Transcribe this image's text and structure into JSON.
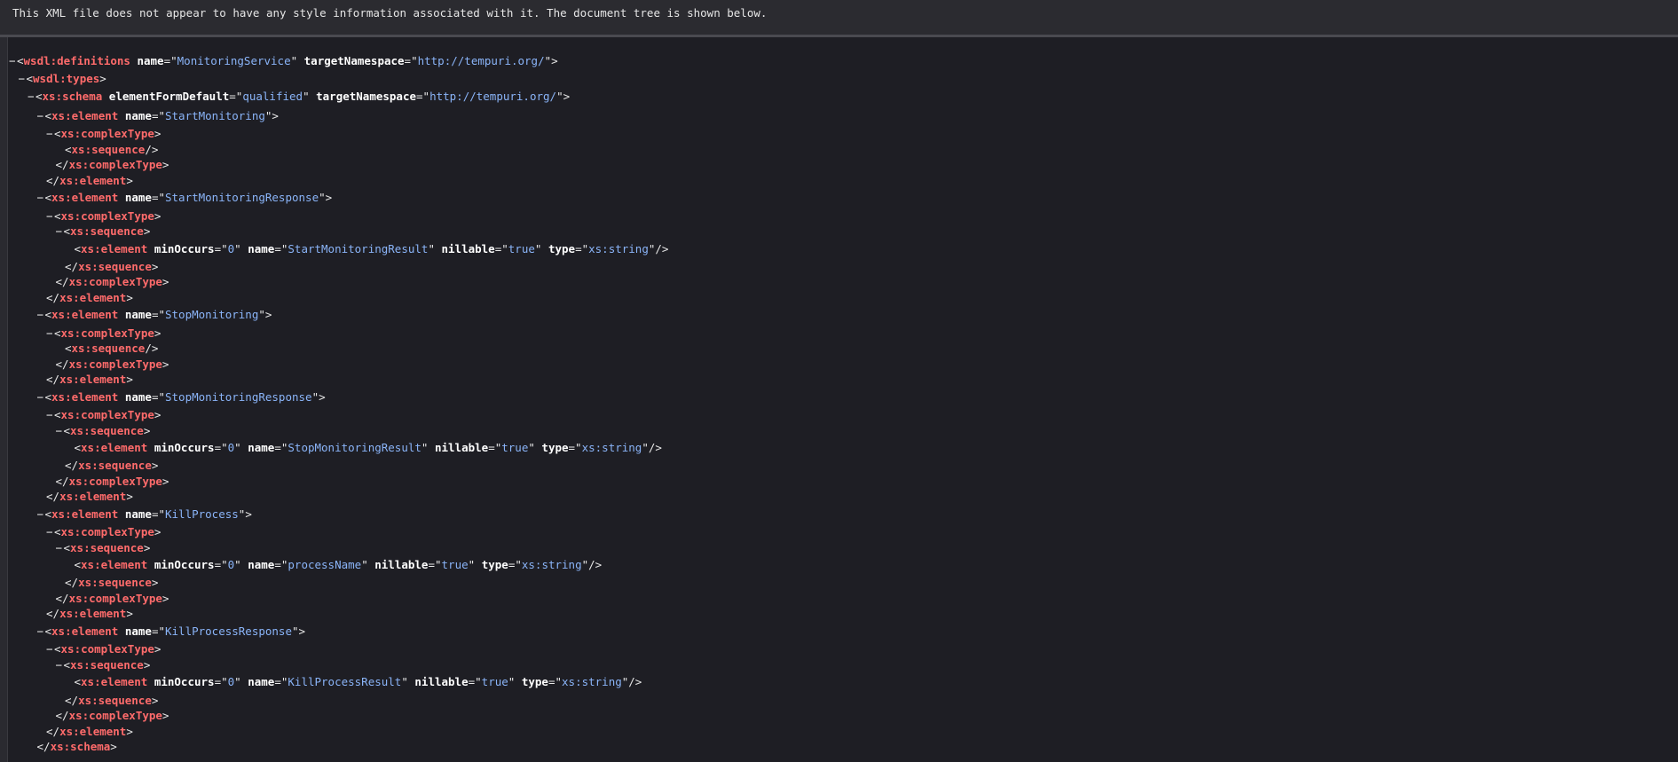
{
  "banner": "This XML file does not appear to have any style information associated with it. The document tree is shown below.",
  "colors": {
    "background": "#1e1e24",
    "header_bg": "#2b2b30",
    "tag": "#ff6b6b",
    "attr_name": "#ffffff",
    "attr_value": "#8ab4f8"
  },
  "fold_glyph": "−",
  "lines": [
    {
      "indent": 0,
      "fold": true,
      "type": "open",
      "tag": "wsdl:definitions",
      "attrs": [
        {
          "n": "name",
          "v": "MonitoringService"
        },
        {
          "n": "targetNamespace",
          "v": "http://tempuri.org/"
        }
      ]
    },
    {
      "indent": 1,
      "fold": true,
      "type": "open",
      "tag": "wsdl:types",
      "attrs": []
    },
    {
      "indent": 2,
      "fold": true,
      "type": "open",
      "tag": "xs:schema",
      "attrs": [
        {
          "n": "elementFormDefault",
          "v": "qualified"
        },
        {
          "n": "targetNamespace",
          "v": "http://tempuri.org/"
        }
      ]
    },
    {
      "indent": 3,
      "fold": true,
      "type": "open",
      "tag": "xs:element",
      "attrs": [
        {
          "n": "name",
          "v": "StartMonitoring"
        }
      ]
    },
    {
      "indent": 4,
      "fold": true,
      "type": "open",
      "tag": "xs:complexType",
      "attrs": []
    },
    {
      "indent": 6,
      "fold": false,
      "type": "self",
      "tag": "xs:sequence",
      "attrs": []
    },
    {
      "indent": 5,
      "fold": false,
      "type": "close",
      "tag": "xs:complexType",
      "attrs": []
    },
    {
      "indent": 4,
      "fold": false,
      "type": "close",
      "tag": "xs:element",
      "attrs": []
    },
    {
      "indent": 3,
      "fold": true,
      "type": "open",
      "tag": "xs:element",
      "attrs": [
        {
          "n": "name",
          "v": "StartMonitoringResponse"
        }
      ]
    },
    {
      "indent": 4,
      "fold": true,
      "type": "open",
      "tag": "xs:complexType",
      "attrs": []
    },
    {
      "indent": 5,
      "fold": true,
      "type": "open",
      "tag": "xs:sequence",
      "attrs": []
    },
    {
      "indent": 7,
      "fold": false,
      "type": "self",
      "tag": "xs:element",
      "attrs": [
        {
          "n": "minOccurs",
          "v": "0"
        },
        {
          "n": "name",
          "v": "StartMonitoringResult"
        },
        {
          "n": "nillable",
          "v": "true"
        },
        {
          "n": "type",
          "v": "xs:string"
        }
      ]
    },
    {
      "indent": 6,
      "fold": false,
      "type": "close",
      "tag": "xs:sequence",
      "attrs": []
    },
    {
      "indent": 5,
      "fold": false,
      "type": "close",
      "tag": "xs:complexType",
      "attrs": []
    },
    {
      "indent": 4,
      "fold": false,
      "type": "close",
      "tag": "xs:element",
      "attrs": []
    },
    {
      "indent": 3,
      "fold": true,
      "type": "open",
      "tag": "xs:element",
      "attrs": [
        {
          "n": "name",
          "v": "StopMonitoring"
        }
      ]
    },
    {
      "indent": 4,
      "fold": true,
      "type": "open",
      "tag": "xs:complexType",
      "attrs": []
    },
    {
      "indent": 6,
      "fold": false,
      "type": "self",
      "tag": "xs:sequence",
      "attrs": []
    },
    {
      "indent": 5,
      "fold": false,
      "type": "close",
      "tag": "xs:complexType",
      "attrs": []
    },
    {
      "indent": 4,
      "fold": false,
      "type": "close",
      "tag": "xs:element",
      "attrs": []
    },
    {
      "indent": 3,
      "fold": true,
      "type": "open",
      "tag": "xs:element",
      "attrs": [
        {
          "n": "name",
          "v": "StopMonitoringResponse"
        }
      ]
    },
    {
      "indent": 4,
      "fold": true,
      "type": "open",
      "tag": "xs:complexType",
      "attrs": []
    },
    {
      "indent": 5,
      "fold": true,
      "type": "open",
      "tag": "xs:sequence",
      "attrs": []
    },
    {
      "indent": 7,
      "fold": false,
      "type": "self",
      "tag": "xs:element",
      "attrs": [
        {
          "n": "minOccurs",
          "v": "0"
        },
        {
          "n": "name",
          "v": "StopMonitoringResult"
        },
        {
          "n": "nillable",
          "v": "true"
        },
        {
          "n": "type",
          "v": "xs:string"
        }
      ]
    },
    {
      "indent": 6,
      "fold": false,
      "type": "close",
      "tag": "xs:sequence",
      "attrs": []
    },
    {
      "indent": 5,
      "fold": false,
      "type": "close",
      "tag": "xs:complexType",
      "attrs": []
    },
    {
      "indent": 4,
      "fold": false,
      "type": "close",
      "tag": "xs:element",
      "attrs": []
    },
    {
      "indent": 3,
      "fold": true,
      "type": "open",
      "tag": "xs:element",
      "attrs": [
        {
          "n": "name",
          "v": "KillProcess"
        }
      ]
    },
    {
      "indent": 4,
      "fold": true,
      "type": "open",
      "tag": "xs:complexType",
      "attrs": []
    },
    {
      "indent": 5,
      "fold": true,
      "type": "open",
      "tag": "xs:sequence",
      "attrs": []
    },
    {
      "indent": 7,
      "fold": false,
      "type": "self",
      "tag": "xs:element",
      "attrs": [
        {
          "n": "minOccurs",
          "v": "0"
        },
        {
          "n": "name",
          "v": "processName"
        },
        {
          "n": "nillable",
          "v": "true"
        },
        {
          "n": "type",
          "v": "xs:string"
        }
      ]
    },
    {
      "indent": 6,
      "fold": false,
      "type": "close",
      "tag": "xs:sequence",
      "attrs": []
    },
    {
      "indent": 5,
      "fold": false,
      "type": "close",
      "tag": "xs:complexType",
      "attrs": []
    },
    {
      "indent": 4,
      "fold": false,
      "type": "close",
      "tag": "xs:element",
      "attrs": []
    },
    {
      "indent": 3,
      "fold": true,
      "type": "open",
      "tag": "xs:element",
      "attrs": [
        {
          "n": "name",
          "v": "KillProcessResponse"
        }
      ]
    },
    {
      "indent": 4,
      "fold": true,
      "type": "open",
      "tag": "xs:complexType",
      "attrs": []
    },
    {
      "indent": 5,
      "fold": true,
      "type": "open",
      "tag": "xs:sequence",
      "attrs": []
    },
    {
      "indent": 7,
      "fold": false,
      "type": "self",
      "tag": "xs:element",
      "attrs": [
        {
          "n": "minOccurs",
          "v": "0"
        },
        {
          "n": "name",
          "v": "KillProcessResult"
        },
        {
          "n": "nillable",
          "v": "true"
        },
        {
          "n": "type",
          "v": "xs:string"
        }
      ]
    },
    {
      "indent": 6,
      "fold": false,
      "type": "close",
      "tag": "xs:sequence",
      "attrs": []
    },
    {
      "indent": 5,
      "fold": false,
      "type": "close",
      "tag": "xs:complexType",
      "attrs": []
    },
    {
      "indent": 4,
      "fold": false,
      "type": "close",
      "tag": "xs:element",
      "attrs": []
    },
    {
      "indent": 3,
      "fold": false,
      "type": "close",
      "tag": "xs:schema",
      "attrs": []
    }
  ]
}
